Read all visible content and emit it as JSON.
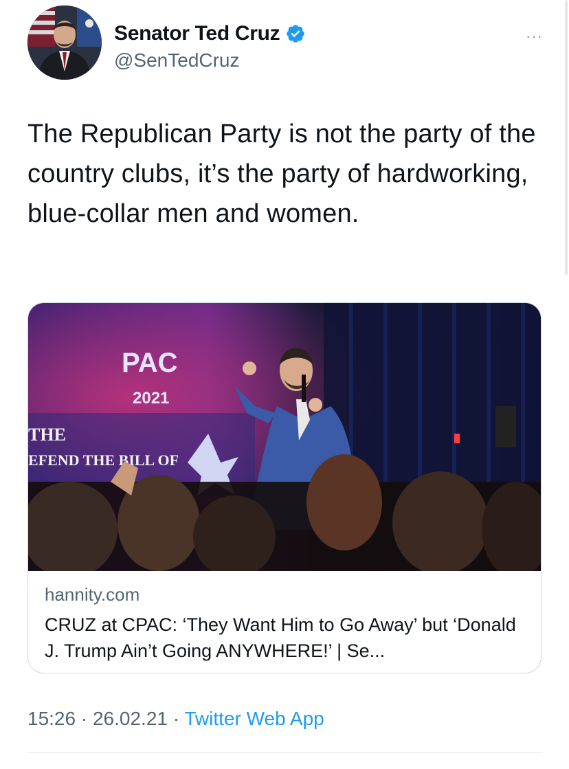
{
  "author": {
    "display_name": "Senator Ted Cruz",
    "handle": "@SenTedCruz",
    "verified": true,
    "avatar_icon": "profile-photo"
  },
  "more_label": "···",
  "tweet": {
    "text": "The Republican Party is not the party of the country clubs, it’s the party of hardworking, blue-collar men and women."
  },
  "card": {
    "image_signage": {
      "pac": "PAC",
      "year": "2021",
      "the": "THE",
      "defend": "EFEND THE BILL OF"
    },
    "domain": "hannity.com",
    "title": "CRUZ at CPAC: ‘They Want Him to Go Away’ but ‘Donald J. Trump Ain’t Going ANYWHERE!’ | Se..."
  },
  "meta": {
    "time": "15:26",
    "date": "26.02.21",
    "separator": " · ",
    "source": "Twitter Web App"
  },
  "colors": {
    "link": "#1d9bf0",
    "secondary_text": "#536471",
    "primary_text": "#0f1419",
    "border": "#cfd9de"
  }
}
